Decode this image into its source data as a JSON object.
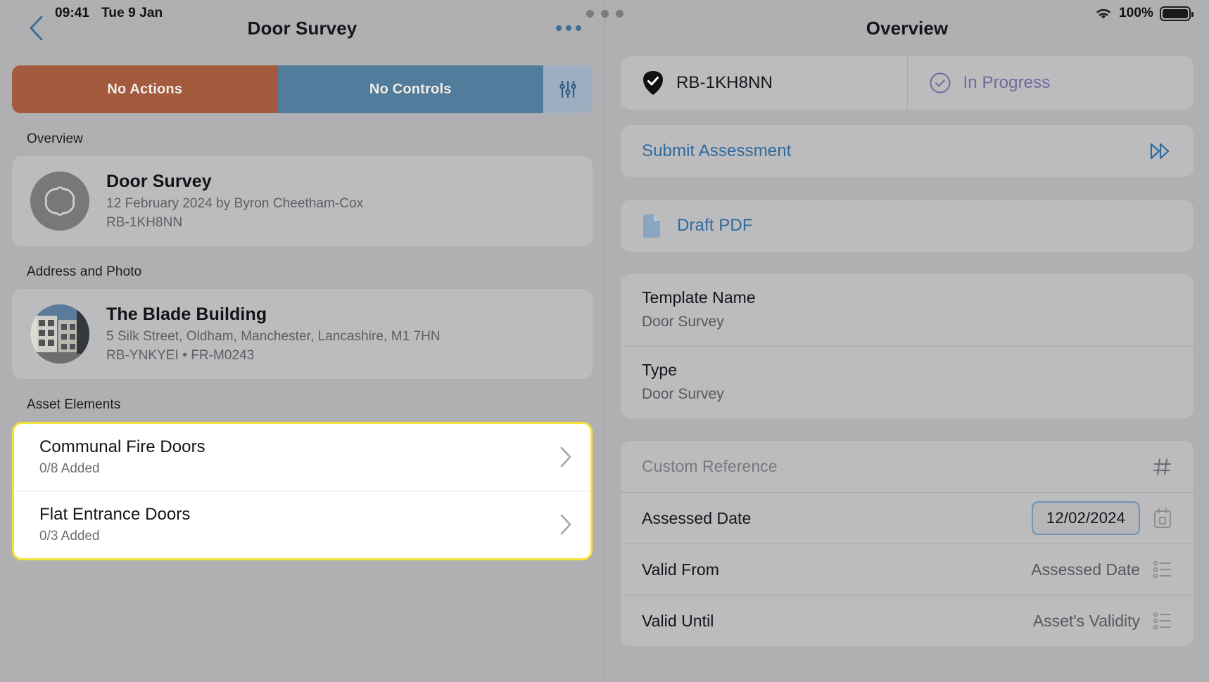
{
  "status_bar": {
    "time": "09:41",
    "date": "Tue 9 Jan",
    "battery_percent": "100%",
    "wifi_icon": "wifi-icon",
    "battery_icon": "battery-icon",
    "multitask_handle_icon": "multitask-handle-icon"
  },
  "left_pane": {
    "nav": {
      "back_icon": "chevron-left-icon",
      "title": "Door Survey",
      "more_icon": "more-horizontal-icon"
    },
    "segmented_control": {
      "segments": [
        {
          "label": "No Actions",
          "color": "#a45a3c"
        },
        {
          "label": "No Controls",
          "color": "#527c9b"
        }
      ],
      "filter_icon": "sliders-filter-icon",
      "filter_bg": "#9daec0"
    },
    "sections": [
      {
        "heading": "Overview",
        "avatar_icon": "rosette-badge-icon",
        "title": "Door Survey",
        "subtitle": "12 February 2024 by Byron Cheetham-Cox",
        "reference": "RB-1KH8NN"
      },
      {
        "heading": "Address and Photo",
        "avatar_icon": "building-photo",
        "title": "The Blade Building",
        "subtitle": "5 Silk Street, Oldham, Manchester, Lancashire, M1 7HN",
        "reference": "RB-YNKYEI • FR-M0243"
      }
    ],
    "asset_elements": {
      "heading": "Asset Elements",
      "highlight_color": "#f5e03c",
      "items": [
        {
          "name": "Communal Fire Doors",
          "count": "0/8 Added",
          "chevron_icon": "chevron-right-icon"
        },
        {
          "name": "Flat Entrance Doors",
          "count": "0/3 Added",
          "chevron_icon": "chevron-right-icon"
        }
      ]
    }
  },
  "right_pane": {
    "nav": {
      "title": "Overview"
    },
    "summary": {
      "reference_icon": "shield-check-icon",
      "reference": "RB-1KH8NN",
      "status_icon": "circle-check-icon",
      "status": "In Progress",
      "status_color": "#6f6a9c"
    },
    "submit": {
      "label": "Submit Assessment",
      "icon": "double-chevron-right-icon",
      "color": "#2f6b9e"
    },
    "draft": {
      "label": "Draft PDF",
      "icon": "document-icon",
      "color": "#2f6b9e"
    },
    "fields": [
      {
        "label": "Template Name",
        "value": "Door Survey"
      },
      {
        "label": "Type",
        "value": "Door Survey"
      }
    ],
    "inline_fields": [
      {
        "label": "Custom Reference",
        "is_placeholder": true,
        "value": "",
        "icon": "hash-icon"
      },
      {
        "label": "Assessed Date",
        "is_placeholder": false,
        "value": "12/02/2024",
        "is_badge": true,
        "icon": "calendar-icon"
      },
      {
        "label": "Valid From",
        "is_placeholder": false,
        "value": "Assessed Date",
        "icon": "list-bullet-icon"
      },
      {
        "label": "Valid Until",
        "is_placeholder": false,
        "value": "Asset's Validity",
        "icon": "list-bullet-icon"
      }
    ]
  }
}
